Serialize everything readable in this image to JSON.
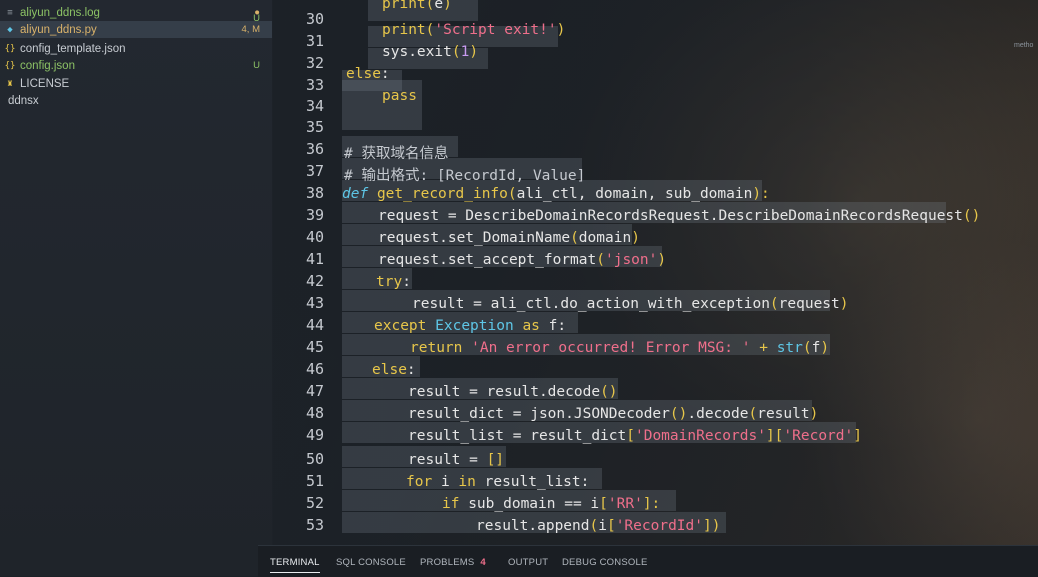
{
  "explorer": {
    "files": [
      {
        "name": "aliyun_ddns.log",
        "icon": "log-file-icon",
        "status": "",
        "dot": true,
        "state": "untracked"
      },
      {
        "name": "aliyun_ddns.py",
        "icon": "python-file-icon",
        "status": "4, M",
        "state": "modified",
        "selected": true
      },
      {
        "name": "config_template.json",
        "icon": "json-file-icon",
        "status": "",
        "state": "normal"
      },
      {
        "name": "config.json",
        "icon": "json-file-icon",
        "status": "U",
        "state": "untracked"
      },
      {
        "name": "LICENSE",
        "icon": "license-file-icon",
        "status": "",
        "state": "normal"
      },
      {
        "name": "ddnsx",
        "icon": "",
        "status": "",
        "state": "normal"
      }
    ],
    "first_row_status": "U"
  },
  "editor": {
    "line_numbers": [
      "30",
      "31",
      "32",
      "33",
      "34",
      "35",
      "36",
      "37",
      "38",
      "39",
      "40",
      "41",
      "42",
      "43",
      "44",
      "45",
      "46",
      "47",
      "48",
      "49",
      "50",
      "51",
      "52",
      "53"
    ],
    "minimap_hint": "metho"
  },
  "panel": {
    "tabs": [
      {
        "label": "TERMINAL",
        "active": true
      },
      {
        "label": "SQL CONSOLE"
      },
      {
        "label": "PROBLEMS",
        "badge": "4"
      },
      {
        "label": "OUTPUT"
      },
      {
        "label": "DEBUG CONSOLE"
      }
    ]
  },
  "code": {
    "l30": [
      "print",
      "(",
      "e",
      ")"
    ],
    "l31": [
      "print",
      "(",
      "'Script exit!'",
      ")"
    ],
    "l32": [
      "sys.exit",
      "(",
      "1",
      ")"
    ],
    "l33": [
      "else",
      ":"
    ],
    "l34": [
      "pass"
    ],
    "l36": "# 获取域名信息",
    "l37": "# 输出格式: [RecordId, Value]",
    "l38": [
      "def",
      "get_record_info",
      "(",
      "ali_ctl, domain, sub_domain",
      "):"
    ],
    "l39": [
      "request = DescribeDomainRecordsRequest.DescribeDomainRecordsRequest",
      "()"
    ],
    "l40": [
      "request.set_DomainName",
      "(",
      "domain",
      ")"
    ],
    "l41": [
      "request.set_accept_format",
      "(",
      "'json'",
      ")"
    ],
    "l42": [
      "try",
      ":"
    ],
    "l43": [
      "result = ali_ctl.do_action_with_exception",
      "(",
      "request",
      ")"
    ],
    "l44": [
      "except",
      "Exception",
      "as",
      "f:"
    ],
    "l45": [
      "return",
      "'An error occurred! Error MSG: '",
      "+",
      "str",
      "(",
      "f",
      ")"
    ],
    "l46": [
      "else",
      ":"
    ],
    "l47": [
      "result = result.decode",
      "()"
    ],
    "l48": [
      "result_dict = json.JSONDecoder",
      "()",
      ".decode",
      "(",
      "result",
      ")"
    ],
    "l49": [
      "result_list = result_dict",
      "[",
      "'DomainRecords'",
      "][",
      "'Record'",
      "]"
    ],
    "l50": [
      "result = ",
      "[]"
    ],
    "l51": [
      "for",
      "i",
      "in",
      "result_list:"
    ],
    "l52": [
      "if",
      "sub_domain == i",
      "[",
      "'RR'",
      "]:"
    ],
    "l53": [
      "result.append",
      "(",
      "i",
      "[",
      "'RecordId'",
      "])"
    ]
  }
}
